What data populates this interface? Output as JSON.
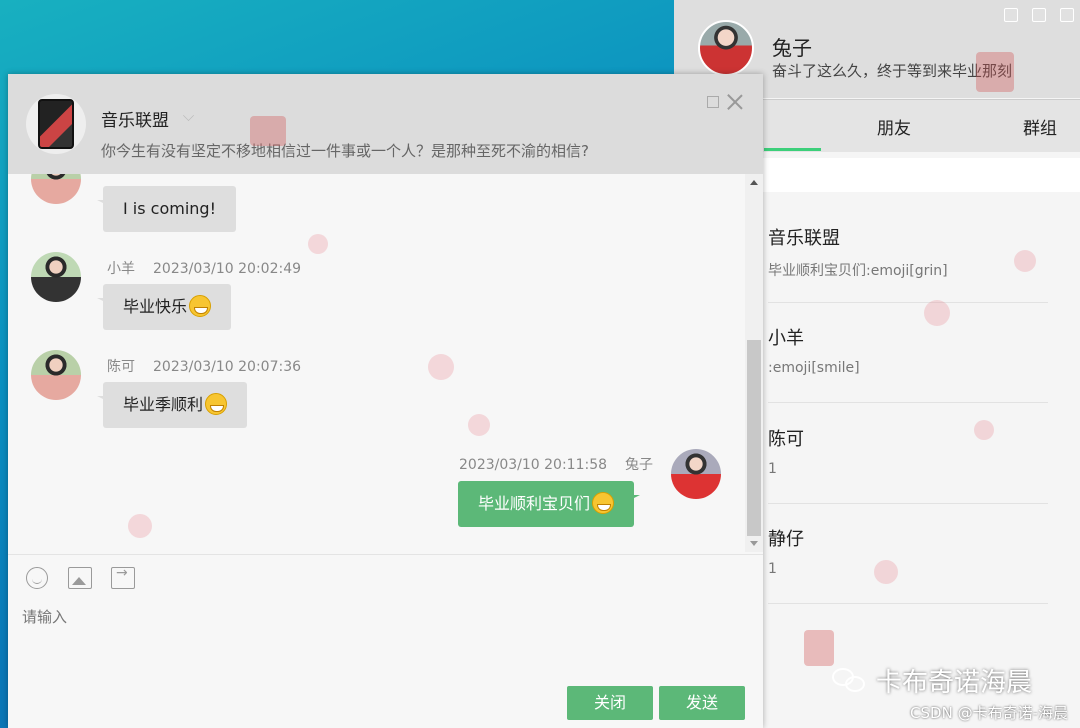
{
  "contacts_panel": {
    "user": {
      "name": "兔子",
      "signature": "奋斗了这么久，终于等到来毕业那刻"
    },
    "tabs": [
      {
        "label": "朋友"
      },
      {
        "label": "群组"
      }
    ],
    "items": [
      {
        "name": "音乐联盟",
        "last_message": "毕业顺利宝贝们:emoji[grin]"
      },
      {
        "name": "小羊",
        "last_message": ":emoji[smile]"
      },
      {
        "name": "陈可",
        "last_message": "1"
      },
      {
        "name": "静仔",
        "last_message": "1"
      }
    ]
  },
  "chat": {
    "group_name": "音乐联盟",
    "group_description": "你今生有没有坚定不移地相信过一件事或一个人？是那种至死不渝的相信?",
    "messages": [
      {
        "text": "I is coming!"
      },
      {
        "sender": "小羊",
        "time": "2023/03/10 20:02:49",
        "text": "毕业快乐"
      },
      {
        "sender": "陈可",
        "time": "2023/03/10 20:07:36",
        "text": "毕业季顺利"
      },
      {
        "sender": "兔子",
        "time": "2023/03/10 20:11:58",
        "text": "毕业顺利宝贝们"
      }
    ],
    "input_placeholder": "请输入",
    "close_label": "关闭",
    "send_label": "发送"
  },
  "watermark": {
    "brand": "卡布奇诺海晨",
    "csdn": "CSDN @卡布奇诺-海晨"
  },
  "colors": {
    "accent_green": "#5cb878",
    "tab_underline": "#3ccf7a"
  }
}
